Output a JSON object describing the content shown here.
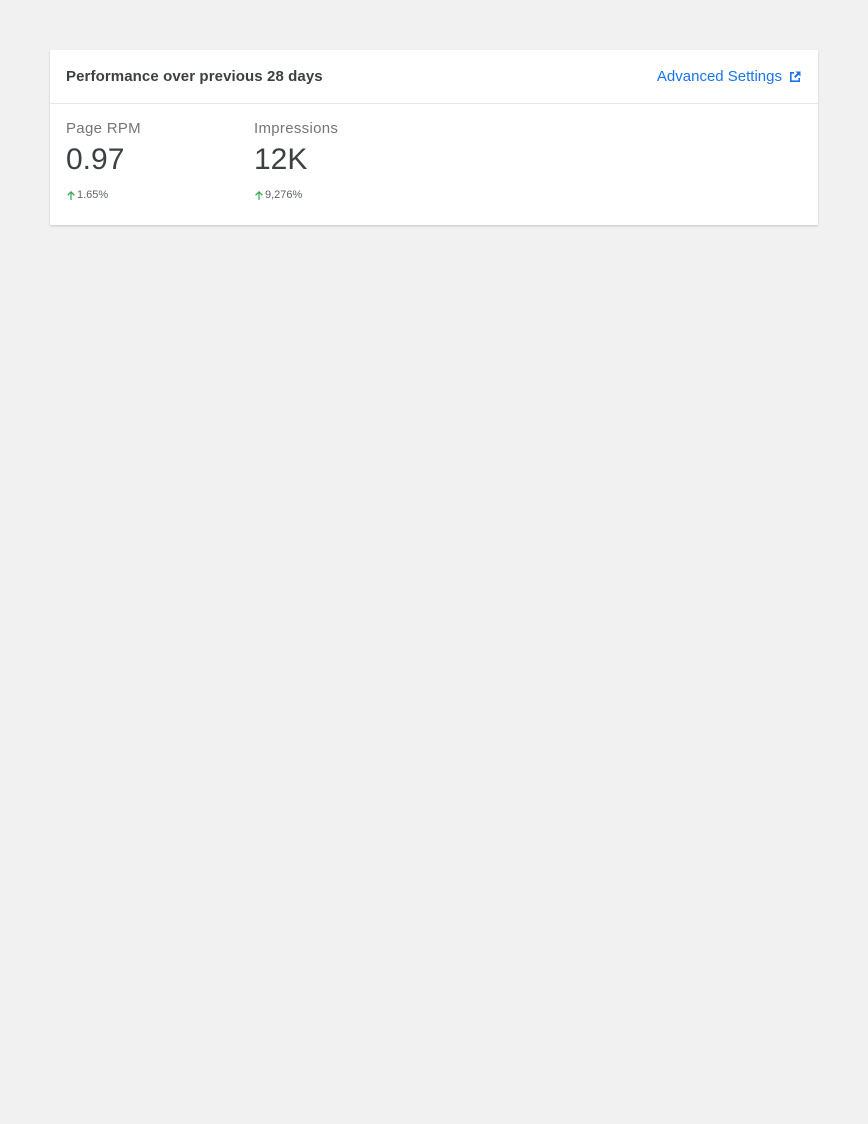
{
  "header": {
    "title": "Performance over previous 28 days",
    "link_label": "Advanced Settings"
  },
  "metrics": [
    {
      "label": "Page RPM",
      "value": "0.97",
      "change": "1.65%",
      "trend": "up"
    },
    {
      "label": "Impressions",
      "value": "12K",
      "change": "9,276%",
      "trend": "up"
    }
  ],
  "colors": {
    "link": "#1a73e8",
    "trend_up": "#34a853",
    "background": "#f1f1f1"
  },
  "icons": {
    "link_icon": "external-link-icon",
    "trend_icon": "arrow-up-icon"
  }
}
